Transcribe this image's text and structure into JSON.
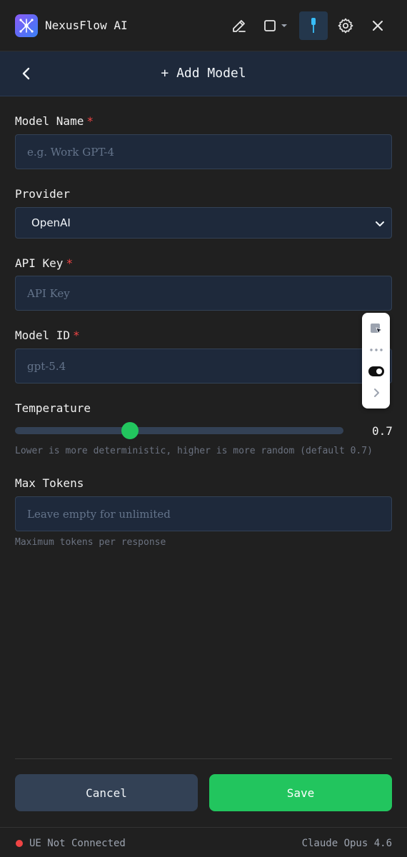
{
  "app": {
    "title": "NexusFlow AI",
    "logo_icon": "network-node-icon",
    "accent": "#8b5cf6"
  },
  "toolbar": {
    "icons": [
      "pencil-icon",
      "square-icon",
      "pin-icon",
      "gear-icon",
      "close-icon"
    ]
  },
  "header": {
    "title": "+ Add Model",
    "back_icon": "chevron-left-icon"
  },
  "form": {
    "model_name": {
      "label": "Model Name",
      "required_mark": "*",
      "placeholder": "e.g. Work GPT-4",
      "value": ""
    },
    "provider": {
      "label": "Provider",
      "selected": "OpenAI"
    },
    "api_key": {
      "label": "API Key",
      "required_mark": "*",
      "placeholder": "API Key",
      "value": ""
    },
    "model_id": {
      "label": "Model ID",
      "required_mark": "*",
      "placeholder": "gpt-5.4",
      "value": ""
    },
    "temperature": {
      "label": "Temperature",
      "value": 0.7,
      "value_text": "0.7",
      "min": 0,
      "max": 2,
      "hint": "Lower is more deterministic, higher is more random (default 0.7)"
    },
    "max_tokens": {
      "label": "Max Tokens",
      "placeholder": "Leave empty for unlimited",
      "value": "",
      "hint": "Maximum tokens per response"
    }
  },
  "actions": {
    "cancel_label": "Cancel",
    "save_label": "Save",
    "save_color": "#22c55e"
  },
  "status": {
    "connection": "UE Not Connected",
    "connection_color": "#ef4444",
    "model": "Claude Opus 4.6"
  },
  "floating_toolbar": {
    "icons": [
      "select-cursor-icon",
      "more-dots-icon",
      "toggle-icon",
      "chevron-right-icon"
    ]
  }
}
